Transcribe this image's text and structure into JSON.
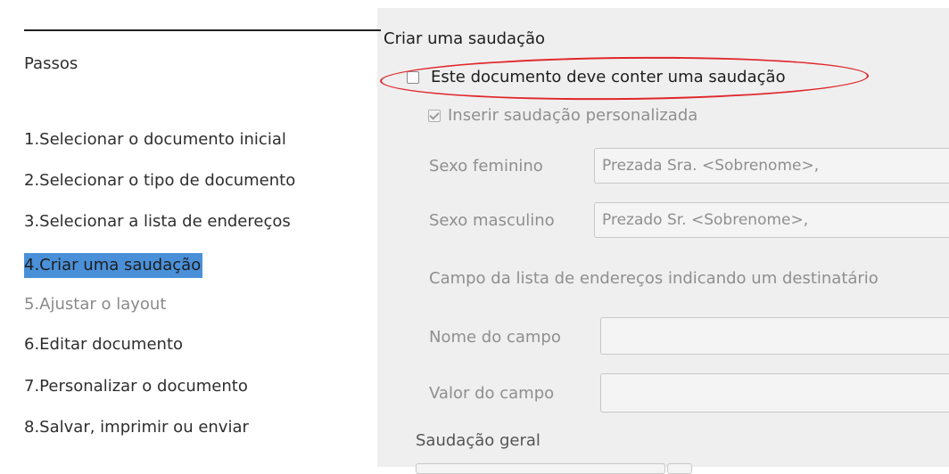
{
  "sidebar": {
    "header": "Passos",
    "steps": [
      {
        "label": "1.Selecionar o documento inicial"
      },
      {
        "label": "2.Selecionar o tipo de documento"
      },
      {
        "label": "3.Selecionar a lista de endereços"
      },
      {
        "label": "4.Criar uma saudação"
      },
      {
        "label": "5.Ajustar o layout"
      },
      {
        "label": "6.Editar documento"
      },
      {
        "label": "7.Personalizar o documento"
      },
      {
        "label": "8.Salvar, imprimir ou enviar"
      }
    ],
    "active_step": 4,
    "disabled_step": 5
  },
  "content": {
    "title": "Criar uma saudação",
    "contains_greeting": {
      "label": "Este documento deve conter uma saudação",
      "checked": false
    },
    "personalized": {
      "label": "Inserir saudação personalizada",
      "checked": true
    },
    "female": {
      "label": "Sexo feminino",
      "value": "Prezada Sra. <Sobrenome>,"
    },
    "male": {
      "label": "Sexo masculino",
      "value": "Prezado Sr. <Sobrenome>,"
    },
    "address_field_caption": "Campo da lista de endereços indicando um destinatário",
    "field_name": {
      "label": "Nome do campo",
      "value": ""
    },
    "field_value": {
      "label": "Valor do campo",
      "value": ""
    },
    "general_greeting": {
      "label": "Saudação geral"
    }
  },
  "colors": {
    "highlight": "#4a90d9",
    "annotation": "#e0262a",
    "pane_background": "#efefef"
  }
}
